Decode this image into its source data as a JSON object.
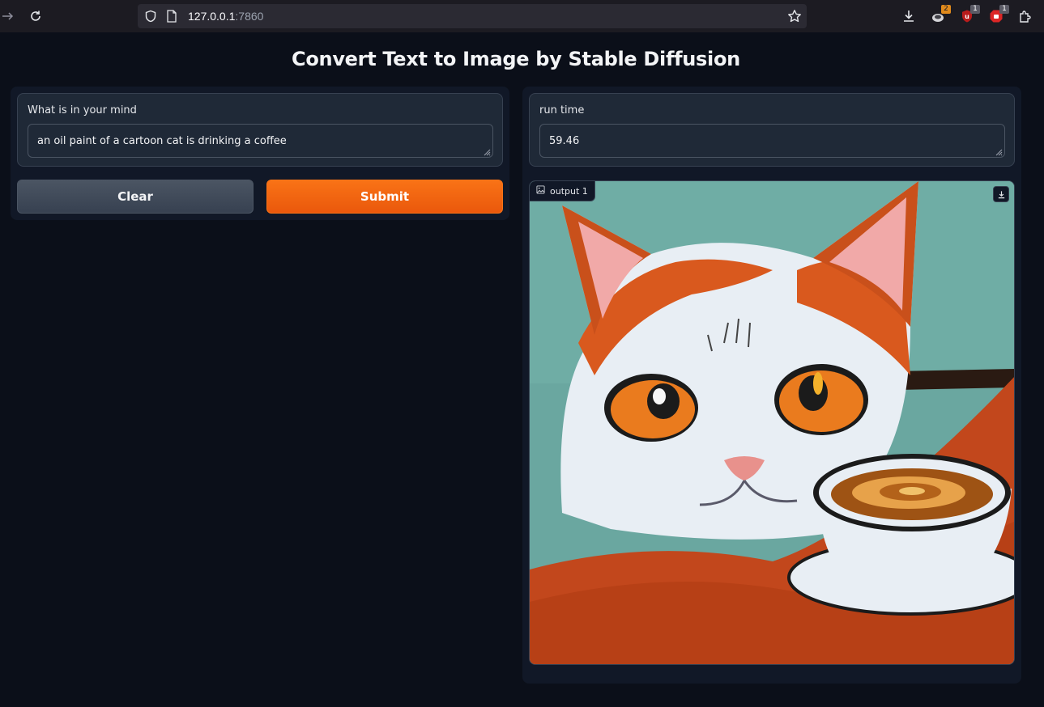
{
  "browser": {
    "url_host": "127.0.0.1",
    "url_port": ":7860",
    "extension_badges": [
      "2",
      "1",
      "1"
    ]
  },
  "page": {
    "title": "Convert Text to Image by Stable Diffusion"
  },
  "input": {
    "label": "What is in your mind",
    "value": "an oil paint of a cartoon cat is drinking a coffee"
  },
  "buttons": {
    "clear_label": "Clear",
    "submit_label": "Submit"
  },
  "output": {
    "runtime_label": "run time",
    "runtime_value": "59.46",
    "image_label": "output 1"
  },
  "colors": {
    "accent": "#f97316",
    "background": "#0b0f19"
  }
}
